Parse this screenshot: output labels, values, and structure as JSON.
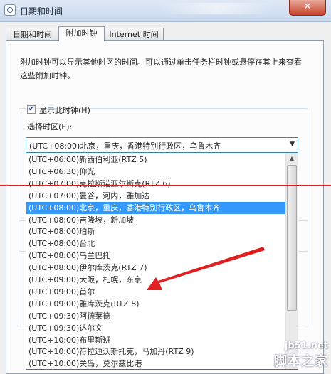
{
  "window": {
    "title": "日期和时间",
    "close_label": "✕"
  },
  "tabs": [
    {
      "label": "日期和时间",
      "active": false
    },
    {
      "label": "附加时钟",
      "active": true
    },
    {
      "label": "Internet 时间",
      "active": false
    }
  ],
  "description": "附加时钟可以显示其他时区的时间。可以通过单击任务栏时钟或悬停在其上来查看这些附加时钟。",
  "clock1": {
    "show_label": "显示此时钟(H)",
    "show_checked": true,
    "timezone_label": "选择时区(E):",
    "selected_value": "(UTC+08:00)北京，重庆，香港特别行政区，乌鲁木齐"
  },
  "dropdown_options": [
    "(UTC+06:00)新西伯利亚(RTZ 5)",
    "(UTC+06:30)仰光",
    "(UTC+07:00)克拉斯诺亚尔斯克(RTZ 6)",
    "(UTC+07:00)曼谷，河内，雅加达",
    "(UTC+08:00)北京，重庆，香港特别行政区，乌鲁木齐",
    "(UTC+08:00)吉隆坡，新加坡",
    "(UTC+08:00)珀斯",
    "(UTC+08:00)台北",
    "(UTC+08:00)乌兰巴托",
    "(UTC+08:00)伊尔库茨克(RTZ 7)",
    "(UTC+09:00)大阪，札幌，东京",
    "(UTC+09:00)首尔",
    "(UTC+09:00)雅库茨克(RTZ 8)",
    "(UTC+09:30)阿德莱德",
    "(UTC+09:30)达尔文",
    "(UTC+10:00)布里斯班",
    "(UTC+10:00)符拉迪沃斯托克，马加丹(RTZ 9)",
    "(UTC+10:00)关岛，莫尔兹比港"
  ],
  "selected_option_index": 4,
  "colors": {
    "selection": "#3399ff",
    "annotation_red": "#e02020"
  },
  "watermark": {
    "domain": "jb51.net",
    "name": "脚本之家"
  },
  "icons": {
    "app": "clock-app-icon",
    "checkbox": "checkbox-icon",
    "dropdown": "chevron-down-icon",
    "scroll_up": "scroll-up-icon"
  }
}
